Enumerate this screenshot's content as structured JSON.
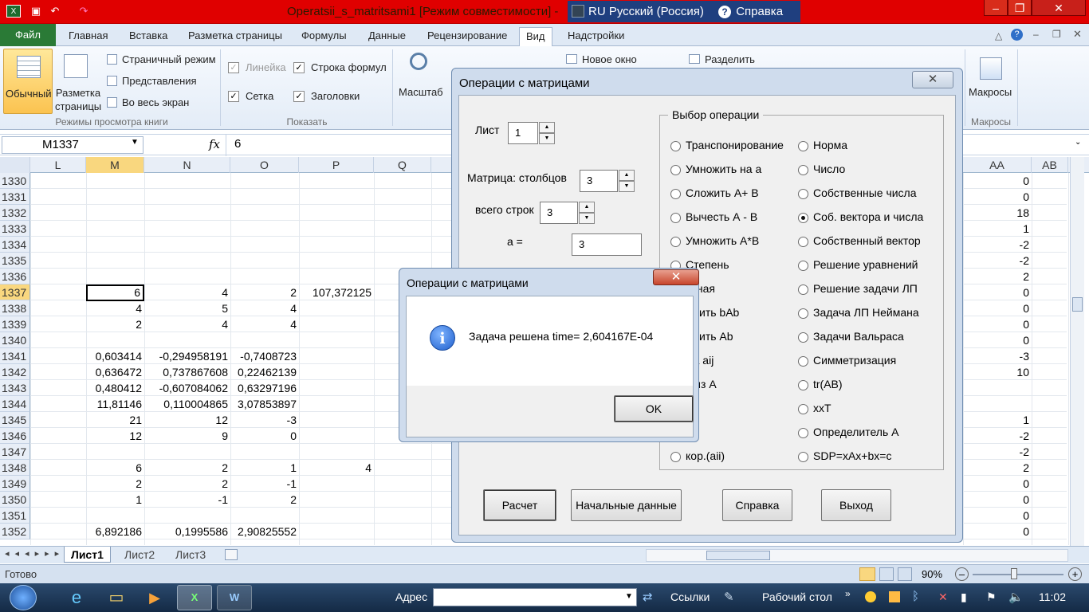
{
  "window": {
    "title": "Operatsii_s_matritsami1  [Режим совместимости]  -"
  },
  "language_bar": {
    "lang_code": "RU",
    "lang_name": "Русский (Россия)",
    "help_label": "Справка"
  },
  "tabs": [
    "Файл",
    "Главная",
    "Вставка",
    "Разметка страницы",
    "Формулы",
    "Данные",
    "Рецензирование",
    "Вид",
    "Надстройки"
  ],
  "ribbon": {
    "normal_label": "Обычный",
    "page_layout_label": "Разметка страницы",
    "page_mode": "Страничный режим",
    "views": "Представления",
    "full_screen": "Во весь экран",
    "group_views": "Режимы просмотра книги",
    "ruler": "Линейка",
    "formula_bar": "Строка формул",
    "grid": "Сетка",
    "headings": "Заголовки",
    "group_show": "Показать",
    "zoom": "Масштаб",
    "new_window": "Новое окно",
    "split": "Разделить",
    "macros": "Макросы",
    "group_macros": "Макросы"
  },
  "formula": {
    "name_box": "M1337",
    "fx": "fx",
    "value": "6"
  },
  "columns": [
    "L",
    "M",
    "N",
    "O",
    "P",
    "Q",
    "AA",
    "AB"
  ],
  "rows": [
    "1330",
    "1331",
    "1332",
    "1333",
    "1334",
    "1335",
    "1336",
    "1337",
    "1338",
    "1339",
    "1340",
    "1341",
    "1342",
    "1343",
    "1344",
    "1345",
    "1346",
    "1347",
    "1348",
    "1349",
    "1350",
    "1351",
    "1352"
  ],
  "cells": {
    "M": [
      "",
      "",
      "",
      "",
      "",
      "",
      "",
      "6",
      "4",
      "2",
      "",
      "0,603414",
      "0,636472",
      "0,480412",
      "11,81146",
      "21",
      "12",
      "",
      "6",
      "2",
      "1",
      "",
      "6,892186"
    ],
    "N": [
      "",
      "",
      "",
      "",
      "",
      "",
      "",
      "4",
      "5",
      "4",
      "",
      "-0,294958191",
      "0,737867608",
      "-0,607084062",
      "0,110004865",
      "12",
      "9",
      "",
      "2",
      "2",
      "-1",
      "",
      "0,1995586"
    ],
    "O": [
      "",
      "",
      "",
      "",
      "",
      "",
      "",
      "2",
      "4",
      "4",
      "",
      "-0,7408723",
      "0,22462139",
      "0,63297196",
      "3,07853897",
      "-3",
      "0",
      "",
      "1",
      "-1",
      "2",
      "",
      "2,90825552"
    ],
    "P": [
      "",
      "",
      "",
      "",
      "",
      "",
      "",
      "107,372125",
      "",
      "",
      "",
      "",
      "",
      "",
      "",
      "",
      "",
      "",
      "4",
      "",
      "",
      "",
      ""
    ],
    "AA": [
      "0",
      "0",
      "18",
      "1",
      "-2",
      "-2",
      "2",
      "0",
      "0",
      "0",
      "0",
      "-3",
      "10",
      "",
      "",
      "1",
      "-2",
      "-2",
      "2",
      "0",
      "0",
      "0",
      "0"
    ]
  },
  "sheets": [
    "Лист1",
    "Лист2",
    "Лист3"
  ],
  "status": {
    "ready": "Готово",
    "zoom": "90%"
  },
  "taskbar": {
    "address_label": "Адрес",
    "links_label": "Ссылки",
    "desktop_label": "Рабочий стол",
    "time": "11:02"
  },
  "userform": {
    "title": "Операции с матрицами",
    "sheet_label": "Лист",
    "sheet_value": "1",
    "cols_label": "Матрица: столбцов",
    "cols_value": "3",
    "rows_label": "всего строк",
    "rows_value": "3",
    "a_label": "а =",
    "a_value": "3",
    "group_title": "Выбор операции",
    "left_ops": [
      "Транспонирование",
      "Умножить на a",
      "Сложить А+ В",
      "Вычесть А - В",
      "Умножить А*В",
      "Степень",
      "атная",
      "ожить bAb",
      "ожить Ab",
      "ма aij",
      "ь из А",
      "а",
      "а",
      "кор.(aii)"
    ],
    "right_ops": [
      "Норма",
      "Число",
      "Собственные числа",
      "Соб. вектора и числа",
      "Собственный вектор",
      "Решение уравнений",
      "Решение задачи ЛП",
      "Задача ЛП Неймана",
      "Задачи Вальраса",
      "Симметризация",
      "tr(AB)",
      "xxT",
      "Определитель А",
      "SDP=xAx+bx=c"
    ],
    "selected_right": 3,
    "buttons": {
      "calc": "Расчет",
      "initial": "Начальные данные",
      "help": "Справка",
      "exit": "Выход"
    }
  },
  "msgbox": {
    "title": "Операции с матрицами",
    "message": "Задача решена  time= 2,604167E-04",
    "ok": "OK"
  }
}
